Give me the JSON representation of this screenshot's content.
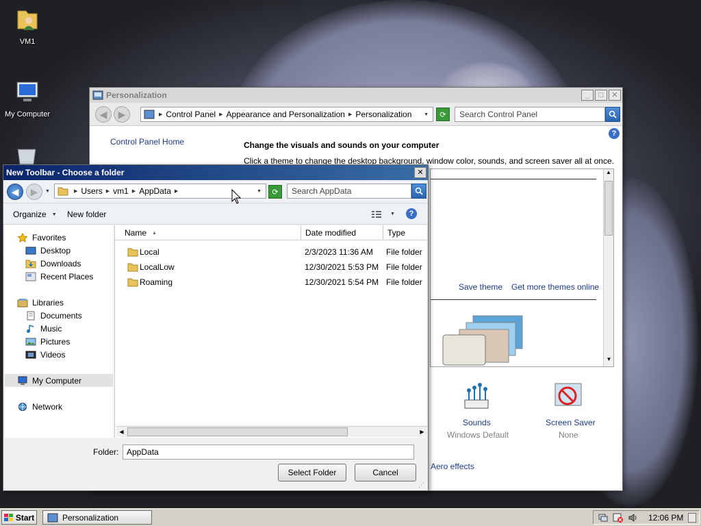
{
  "desktop": {
    "icons": [
      {
        "label": "VM1",
        "icon": "user-folder-icon"
      },
      {
        "label": "My Computer",
        "icon": "computer-icon"
      }
    ]
  },
  "personalization": {
    "title": "Personalization",
    "breadcrumb": [
      "Control Panel",
      "Appearance and Personalization",
      "Personalization"
    ],
    "search_placeholder": "Search Control Panel",
    "sidebar_link": "Control Panel Home",
    "heading": "Change the visuals and sounds on your computer",
    "description": "Click a theme to change the desktop background, window color, sounds, and screen saver all at once.",
    "save_theme": "Save theme",
    "more_themes": "Get more themes online",
    "sounds_label": "Sounds",
    "sounds_value": "Windows Default",
    "screensaver_label": "Screen Saver",
    "screensaver_value": "None",
    "aero_link": "Aero effects"
  },
  "dialog": {
    "title": "New Toolbar - Choose a folder",
    "breadcrumb": [
      "Users",
      "vm1",
      "AppData"
    ],
    "search_placeholder": "Search AppData",
    "toolbar": {
      "organize": "Organize",
      "new_folder": "New folder"
    },
    "nav": {
      "favorites": "Favorites",
      "favorites_items": [
        "Desktop",
        "Downloads",
        "Recent Places"
      ],
      "libraries": "Libraries",
      "libraries_items": [
        "Documents",
        "Music",
        "Pictures",
        "Videos"
      ],
      "computer": "My Computer",
      "network": "Network"
    },
    "columns": [
      "Name",
      "Date modified",
      "Type"
    ],
    "files": [
      {
        "name": "Local",
        "date": "2/3/2023 11:36 AM",
        "type": "File folder"
      },
      {
        "name": "LocalLow",
        "date": "12/30/2021 5:53 PM",
        "type": "File folder"
      },
      {
        "name": "Roaming",
        "date": "12/30/2021 5:54 PM",
        "type": "File folder"
      }
    ],
    "folder_label": "Folder:",
    "folder_value": "AppData",
    "select_button": "Select Folder",
    "cancel_button": "Cancel"
  },
  "taskbar": {
    "start": "Start",
    "task": "Personalization",
    "clock": "12:06 PM"
  }
}
